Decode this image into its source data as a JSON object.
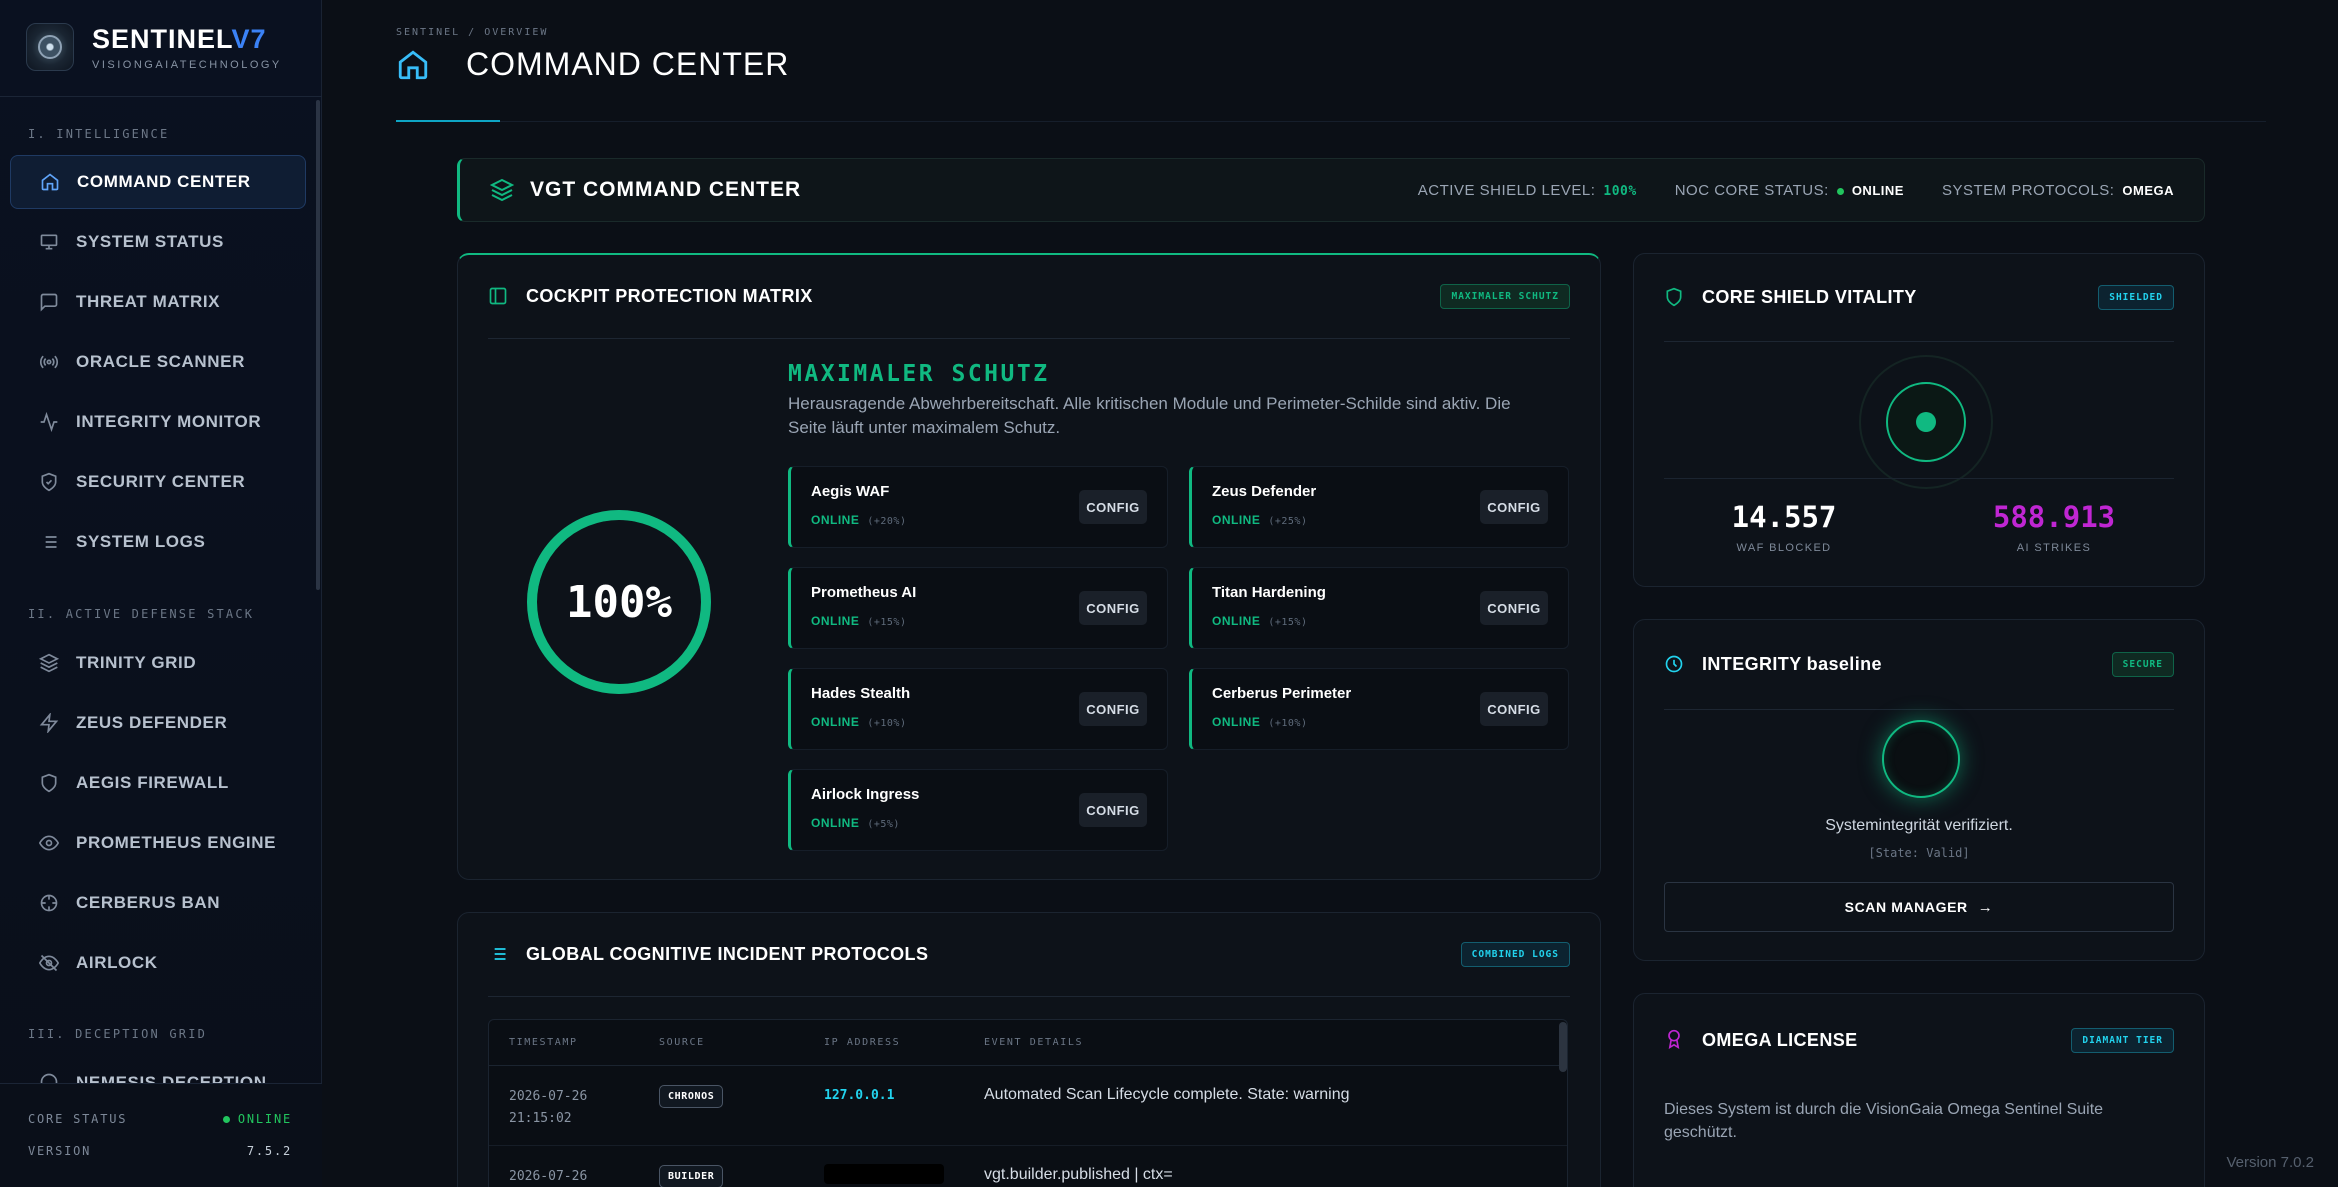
{
  "brand": {
    "name": "SENTINEL",
    "version_mark": "V7",
    "subtitle": "VISIONGAIATECHNOLOGY"
  },
  "sidebar": {
    "sections": [
      {
        "label": "I. INTELLIGENCE"
      },
      {
        "label": "II. ACTIVE DEFENSE STACK"
      },
      {
        "label": "III. DECEPTION GRID"
      }
    ],
    "items": [
      {
        "label": "COMMAND CENTER",
        "icon": "home-icon",
        "active": true
      },
      {
        "label": "SYSTEM STATUS",
        "icon": "monitor-icon"
      },
      {
        "label": "THREAT MATRIX",
        "icon": "message-square-icon"
      },
      {
        "label": "ORACLE SCANNER",
        "icon": "radio-icon"
      },
      {
        "label": "INTEGRITY MONITOR",
        "icon": "activity-icon"
      },
      {
        "label": "SECURITY CENTER",
        "icon": "shield-check-icon"
      },
      {
        "label": "SYSTEM LOGS",
        "icon": "list-icon"
      },
      {
        "label": "TRINITY GRID",
        "icon": "layers-icon"
      },
      {
        "label": "ZEUS DEFENDER",
        "icon": "zap-icon"
      },
      {
        "label": "AEGIS FIREWALL",
        "icon": "shield-icon"
      },
      {
        "label": "PROMETHEUS ENGINE",
        "icon": "eye-icon"
      },
      {
        "label": "CERBERUS BAN",
        "icon": "crosshair-icon"
      },
      {
        "label": "AIRLOCK",
        "icon": "eye-off-icon"
      },
      {
        "label": "NEMESIS DECEPTION",
        "icon": "ghost-icon"
      }
    ],
    "footer": {
      "core_status_label": "CORE STATUS",
      "core_status_value": "ONLINE",
      "version_label": "VERSION",
      "version_value": "7.5.2"
    }
  },
  "header": {
    "breadcrumb": "SENTINEL / OVERVIEW",
    "title": "COMMAND CENTER"
  },
  "banner": {
    "title": "VGT COMMAND CENTER",
    "shield_label": "ACTIVE SHIELD LEVEL:",
    "shield_value": "100%",
    "noc_label": "NOC CORE STATUS:",
    "noc_value": "ONLINE",
    "protocols_label": "SYSTEM PROTOCOLS:",
    "protocols_value": "OMEGA"
  },
  "cockpit": {
    "title": "COCKPIT PROTECTION MATRIX",
    "tag": "MAXIMALER SCHUTZ",
    "ring_value": "100%",
    "ring_level": 1.0,
    "headline": "MAXIMALER SCHUTZ",
    "description": "Herausragende Abwehrbereitschaft. Alle kritischen Module und Perimeter-Schilde sind aktiv. Die Seite läuft unter maximalem Schutz.",
    "modules": [
      {
        "name": "Aegis WAF",
        "status": "ONLINE",
        "delta": "(+20%)",
        "button": "CONFIG"
      },
      {
        "name": "Zeus Defender",
        "status": "ONLINE",
        "delta": "(+25%)",
        "button": "CONFIG"
      },
      {
        "name": "Prometheus AI",
        "status": "ONLINE",
        "delta": "(+15%)",
        "button": "CONFIG"
      },
      {
        "name": "Titan Hardening",
        "status": "ONLINE",
        "delta": "(+15%)",
        "button": "CONFIG"
      },
      {
        "name": "Hades Stealth",
        "status": "ONLINE",
        "delta": "(+10%)",
        "button": "CONFIG"
      },
      {
        "name": "Cerberus Perimeter",
        "status": "ONLINE",
        "delta": "(+10%)",
        "button": "CONFIG"
      },
      {
        "name": "Airlock Ingress",
        "status": "ONLINE",
        "delta": "(+5%)",
        "button": "CONFIG"
      }
    ]
  },
  "incidents": {
    "title": "GLOBAL COGNITIVE INCIDENT PROTOCOLS",
    "tag": "COMBINED LOGS",
    "columns": [
      "TIMESTAMP",
      "SOURCE",
      "IP ADDRESS",
      "EVENT DETAILS"
    ],
    "rows": [
      {
        "date": "2026-07-26",
        "time": "21:15:02",
        "source": "CHRONOS",
        "ip": "127.0.0.1",
        "event": "Automated Scan Lifecycle complete. State: warning"
      },
      {
        "date": "2026-07-26",
        "time": "",
        "source": "BUILDER",
        "ip": "",
        "event": "vgt.builder.published | ctx="
      }
    ]
  },
  "core_shield": {
    "title": "CORE SHIELD VITALITY",
    "tag": "SHIELDED",
    "waf_blocked_value": "14.557",
    "waf_blocked_label": "WAF BLOCKED",
    "ai_strikes_value": "588.913",
    "ai_strikes_label": "AI STRIKES"
  },
  "integrity": {
    "title": "INTEGRITY baseline",
    "tag": "SECURE",
    "message": "Systemintegrität verifiziert.",
    "state": "[State: Valid]",
    "button": "SCAN MANAGER"
  },
  "omega": {
    "title": "OMEGA LICENSE",
    "tag": "DIAMANT TIER",
    "text": "Dieses System ist durch die VisionGaia Omega Sentinel Suite geschützt."
  },
  "version_text": "Version 7.0.2",
  "colors": {
    "accent_green": "#10b981",
    "accent_cyan": "#22d3ee",
    "accent_purple": "#c026d3",
    "brand_blue": "#3b82f6"
  }
}
